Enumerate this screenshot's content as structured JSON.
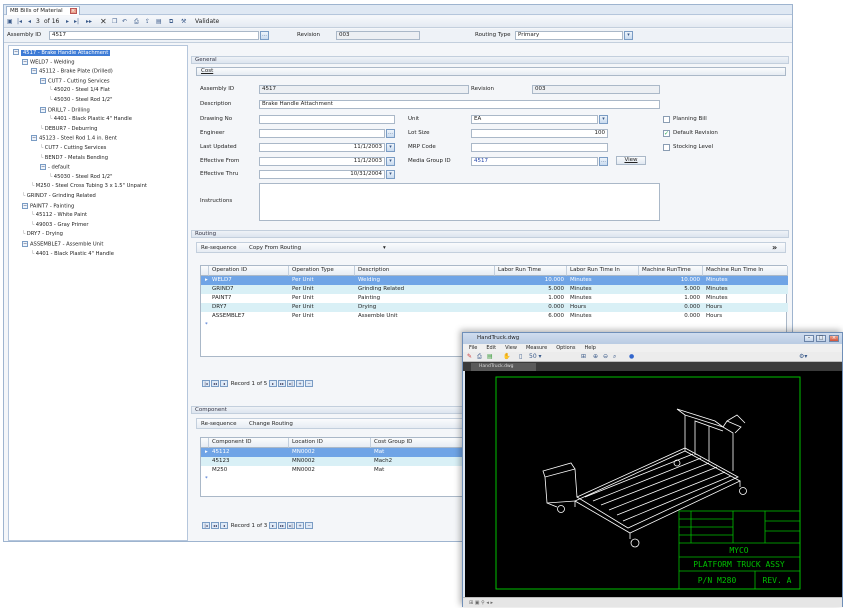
{
  "tab": {
    "title": "MB Bills of Material"
  },
  "toolbar": {
    "record": "3",
    "of": "of 16",
    "validate": "Validate"
  },
  "header": {
    "assembly_label": "Assembly ID",
    "assembly_value": "4517",
    "revision_label": "Revision",
    "revision_value": "003",
    "routing_label": "Routing Type",
    "routing_value": "Primary"
  },
  "tree": [
    {
      "text": "4517 - Brake Handle Attachment",
      "depth": 0,
      "box": "−",
      "sel": true
    },
    {
      "text": "WELD7 - Welding",
      "depth": 1,
      "box": "−"
    },
    {
      "text": "45112 - Brake Plate (Drilled)",
      "depth": 2,
      "box": "−"
    },
    {
      "text": "CUT7 - Cutting Services",
      "depth": 3,
      "box": "−"
    },
    {
      "text": "45020 - Steel 1/4 Flat",
      "depth": 4
    },
    {
      "text": "45030 - Steel Rod 1/2\"",
      "depth": 4
    },
    {
      "text": "DRILL7 - Drilling",
      "depth": 3,
      "box": "−"
    },
    {
      "text": "4401 - Black Plastic 4\" Handle",
      "depth": 4
    },
    {
      "text": "DEBUR7 - Deburring",
      "depth": 3
    },
    {
      "text": "45123 - Steel Rod 1.4 in. Bent",
      "depth": 2,
      "box": "−"
    },
    {
      "text": "CUT7 - Cutting Services",
      "depth": 3
    },
    {
      "text": "BEND7 - Metals Bending",
      "depth": 3
    },
    {
      "text": "- default",
      "depth": 3,
      "box": "−"
    },
    {
      "text": "45030 - Steel Rod 1/2\"",
      "depth": 4
    },
    {
      "text": "M250 - Steel Cross Tubing 3 x 1.5\" Unpaint",
      "depth": 2
    },
    {
      "text": "GRIND7 - Grinding Related",
      "depth": 1
    },
    {
      "text": "PAINT7 - Painting",
      "depth": 1,
      "box": "−"
    },
    {
      "text": "45112 - White Paint",
      "depth": 2
    },
    {
      "text": "49003 - Gray Primer",
      "depth": 2
    },
    {
      "text": "DRY7 - Drying",
      "depth": 1
    },
    {
      "text": "ASSEMBLE7 - Assemble Unit",
      "depth": 1,
      "box": "−"
    },
    {
      "text": "4401 - Black Plastic 4\" Handle",
      "depth": 2
    }
  ],
  "general": {
    "title": "General",
    "cost": "Cost",
    "assembly_id_label": "Assembly ID",
    "assembly_id": "4517",
    "revision_label": "Revision",
    "revision": "003",
    "description_label": "Description",
    "description": "Brake Handle Attachment",
    "drawing_label": "Drawing No",
    "unit_label": "Unit",
    "unit": "EA",
    "engineer_label": "Engineer",
    "lot_label": "Lot Size",
    "lot": "100",
    "last_updated_label": "Last Updated",
    "last_updated": "11/1/2003",
    "mrp_label": "MRP Code",
    "eff_from_label": "Effective From",
    "eff_from": "11/1/2003",
    "media_label": "Media Group ID",
    "media": "4517",
    "view": "View",
    "eff_thru_label": "Effective Thru",
    "eff_thru": "10/31/2004",
    "instructions_label": "Instructions",
    "planning_bill": "Planning Bill",
    "default_revision": "Default Revision",
    "stocking_level": "Stocking Level"
  },
  "routing": {
    "title": "Routing",
    "resequence": "Re-sequence",
    "copy": "Copy From Routing",
    "columns": [
      "Operation ID",
      "Operation Type",
      "Description",
      "Labor Run Time",
      "Labor Run Time In",
      "Machine RunTime",
      "Machine Run Time In"
    ],
    "rows": [
      [
        "WELD7",
        "Per Unit",
        "Welding",
        "10.000",
        "Minutes",
        "10.000",
        "Minutes"
      ],
      [
        "GRIND7",
        "Per Unit",
        "Grinding Related",
        "5.000",
        "Minutes",
        "5.000",
        "Minutes"
      ],
      [
        "PAINT7",
        "Per Unit",
        "Painting",
        "1.000",
        "Minutes",
        "1.000",
        "Minutes"
      ],
      [
        "DRY7",
        "Per Unit",
        "Drying",
        "0.000",
        "Hours",
        "0.000",
        "Hours"
      ],
      [
        "ASSEMBLE7",
        "Per Unit",
        "Assemble Unit",
        "6.000",
        "Minutes",
        "0.000",
        "Hours"
      ]
    ],
    "nav": "Record 1 of 5"
  },
  "component": {
    "title": "Component",
    "resequence": "Re-sequence",
    "change": "Change Routing",
    "columns": [
      "Component ID",
      "Location ID",
      "Cost Group ID"
    ],
    "rows": [
      [
        "45112",
        "MN0002",
        "Mat"
      ],
      [
        "45123",
        "MN0002",
        "Mach2"
      ],
      [
        "M250",
        "MN0002",
        "Mat"
      ]
    ],
    "nav": "Record 1 of 3"
  },
  "cad": {
    "title": "HandTruck.dwg",
    "menu": [
      "File",
      "Edit",
      "View",
      "Measure",
      "Options",
      "Help"
    ],
    "tab": "HandTruck.dwg",
    "company": "MYCO",
    "part_title": "PLATFORM TRUCK ASSY",
    "part_no": "P/N M280",
    "rev": "REV. A"
  },
  "colors": {
    "selection": "#6fa4e6",
    "alt_row": "#d9f0f6",
    "cad_lines": "#ffffff",
    "cad_border": "#00c000"
  }
}
